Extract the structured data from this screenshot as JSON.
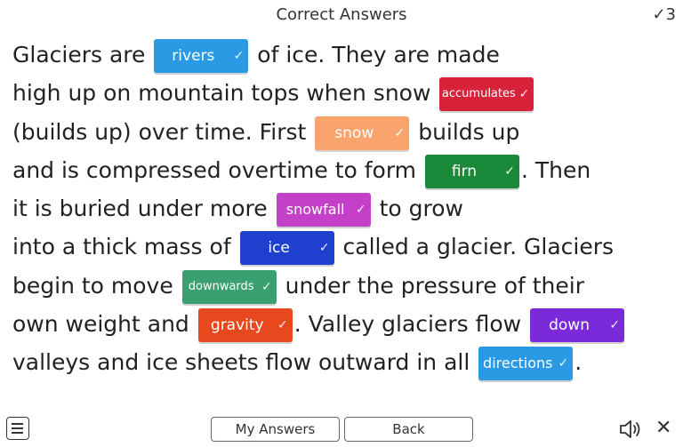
{
  "header": {
    "title": "Correct Answers",
    "score_icon": "check-icon",
    "score_mark": "✓",
    "score_value": "3"
  },
  "passage": {
    "lines": [
      [
        {
          "t": "text",
          "v": "Glaciers are "
        },
        {
          "t": "chip",
          "v": "rivers",
          "color": "#2a9ae4",
          "w": 106
        },
        {
          "t": "text",
          "v": " of ice. They are made"
        }
      ],
      [
        {
          "t": "text",
          "v": "high up on mountain tops when snow "
        },
        {
          "t": "chip",
          "v": "accumulates",
          "color": "#d8223a",
          "w": 106,
          "size": "small"
        }
      ],
      [
        {
          "t": "text",
          "v": "(builds up) over time. First "
        },
        {
          "t": "chip",
          "v": "snow",
          "color": "#f8a46c",
          "w": 106
        },
        {
          "t": "text",
          "v": " builds up"
        }
      ],
      [
        {
          "t": "text",
          "v": "and is compressed overtime to form "
        },
        {
          "t": "chip",
          "v": "firn",
          "color": "#1a8a3a",
          "w": 106
        },
        {
          "t": "text",
          "v": ". Then"
        }
      ],
      [
        {
          "t": "text",
          "v": "it is buried under more "
        },
        {
          "t": "chip",
          "v": "snowfall",
          "color": "#c540c9",
          "w": 106,
          "size": "mid"
        },
        {
          "t": "text",
          "v": " to grow"
        }
      ],
      [
        {
          "t": "text",
          "v": "into a thick mass of "
        },
        {
          "t": "chip",
          "v": "ice",
          "color": "#1f3fcf",
          "w": 106
        },
        {
          "t": "text",
          "v": " called a glacier. Glaciers"
        }
      ],
      [
        {
          "t": "text",
          "v": "begin to move "
        },
        {
          "t": "chip",
          "v": "downwards",
          "color": "#3aa070",
          "w": 106,
          "size": "small"
        },
        {
          "t": "text",
          "v": " under the pressure of their"
        }
      ],
      [
        {
          "t": "text",
          "v": "own weight and "
        },
        {
          "t": "chip",
          "v": "gravity",
          "color": "#e8481e",
          "w": 106
        },
        {
          "t": "text",
          "v": ". Valley glaciers flow "
        },
        {
          "t": "chip",
          "v": "down",
          "color": "#7a2ad8",
          "w": 106
        }
      ],
      [
        {
          "t": "text",
          "v": "valleys and ice sheets flow outward in all "
        },
        {
          "t": "chip",
          "v": "directions",
          "color": "#2a9ae4",
          "w": 106,
          "size": "mid"
        },
        {
          "t": "text",
          "v": "."
        }
      ]
    ]
  },
  "footer": {
    "menu_icon": "hamburger-menu-icon",
    "my_answers_label": "My Answers",
    "back_label": "Back",
    "speaker_icon": "speaker-icon",
    "close_icon": "close-icon",
    "close_glyph": "✕"
  }
}
